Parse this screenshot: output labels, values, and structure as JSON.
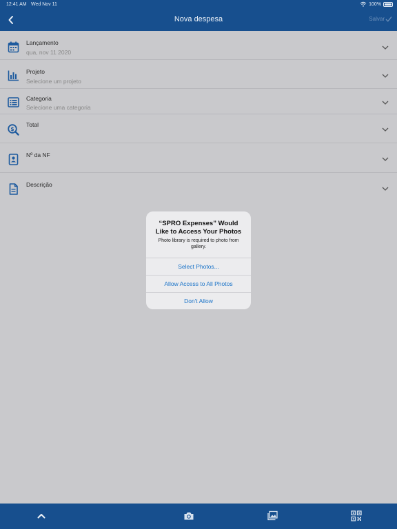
{
  "status_bar": {
    "time": "12:41 AM",
    "date": "Wed Nov 11",
    "battery": "100%",
    "wifi_icon": "wifi-icon",
    "battery_icon": "battery-icon"
  },
  "header": {
    "title": "Nova despesa",
    "save_label": "Salvar",
    "back_icon": "chevron-left-icon",
    "save_icon": "checkmark-icon"
  },
  "form": {
    "fields": [
      {
        "label": "Lançamento",
        "value": "qua, nov 11 2020",
        "icon": "calendar-icon"
      },
      {
        "label": "Projeto",
        "value": "Selecione um projeto",
        "icon": "bar-chart-icon"
      },
      {
        "label": "Categoria",
        "value": "Selecione uma categoria",
        "icon": "list-icon"
      },
      {
        "label": "Total",
        "value": "",
        "icon": "money-search-icon"
      },
      {
        "label": "Nº da NF",
        "value": "",
        "icon": "id-card-icon"
      },
      {
        "label": "Descrição",
        "value": "",
        "icon": "document-icon"
      }
    ]
  },
  "alert": {
    "title": "“SPRO Expenses” Would Like to Access Your Photos",
    "message": "Photo library is required to photo from gallery.",
    "buttons": [
      "Select Photos...",
      "Allow Access to All Photos",
      "Don't Allow"
    ]
  },
  "bottom_bar": {
    "icons": [
      "chevron-up-icon",
      "camera-icon",
      "gallery-icon",
      "qr-code-icon"
    ]
  },
  "colors": {
    "primary": "#174f8e",
    "icon_blue": "#1d5a9e",
    "alert_button": "#1a73c8",
    "dim_background": "#c9c9cc"
  }
}
